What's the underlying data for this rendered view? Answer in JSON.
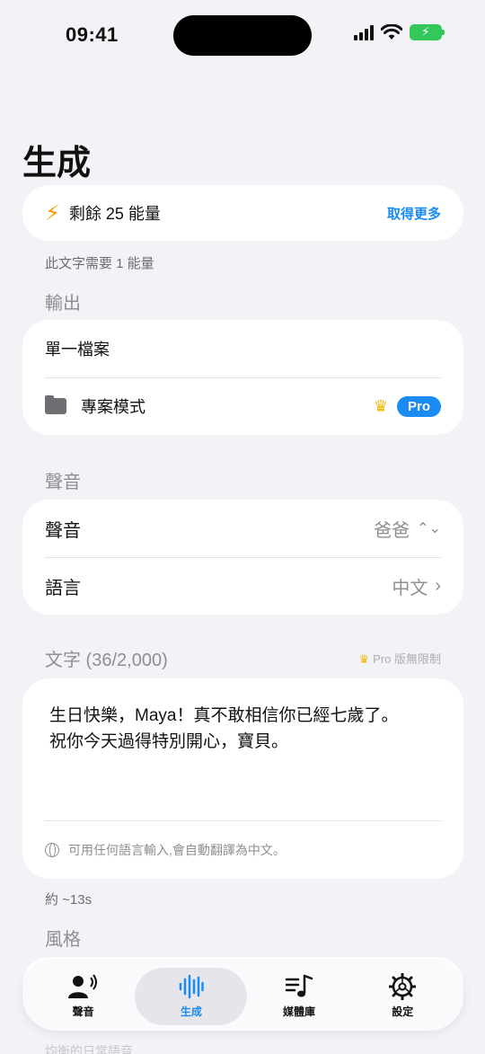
{
  "status": {
    "time": "09:41"
  },
  "page": {
    "title": "生成"
  },
  "energy": {
    "text": "剩餘 25 能量",
    "get_more": "取得更多",
    "note": "此文字需要 1 能量"
  },
  "output": {
    "label": "輸出",
    "single_file": "單一檔案",
    "project_mode": "專案模式",
    "pro_badge": "Pro"
  },
  "voice_section": {
    "label": "聲音",
    "voice_label": "聲音",
    "voice_value": "爸爸",
    "language_label": "語言",
    "language_value": "中文"
  },
  "text_section": {
    "label": "文字 (36/2,000)",
    "pro_unlimited": "Pro 版無限制",
    "content": "生日快樂，Maya！真不敢相信你已經七歲了。\n祝你今天過得特別開心，寶貝。",
    "hint": "可用任何語言輸入,會自動翻譯為中文。",
    "duration": "約 ~13s"
  },
  "style_section": {
    "label": "風格"
  },
  "tabs": [
    {
      "label": "聲音",
      "icon": "speaker-person-icon",
      "active": false
    },
    {
      "label": "生成",
      "icon": "waveform-icon",
      "active": true
    },
    {
      "label": "媒體庫",
      "icon": "music-list-icon",
      "active": false
    },
    {
      "label": "設定",
      "icon": "gear-icon",
      "active": false
    }
  ],
  "bottom_peek": "均衡的日常語音",
  "colors": {
    "accent": "#1a8bf0",
    "energy": "#ff9500",
    "crown": "#f5b800",
    "background": "#f2f2f7"
  }
}
